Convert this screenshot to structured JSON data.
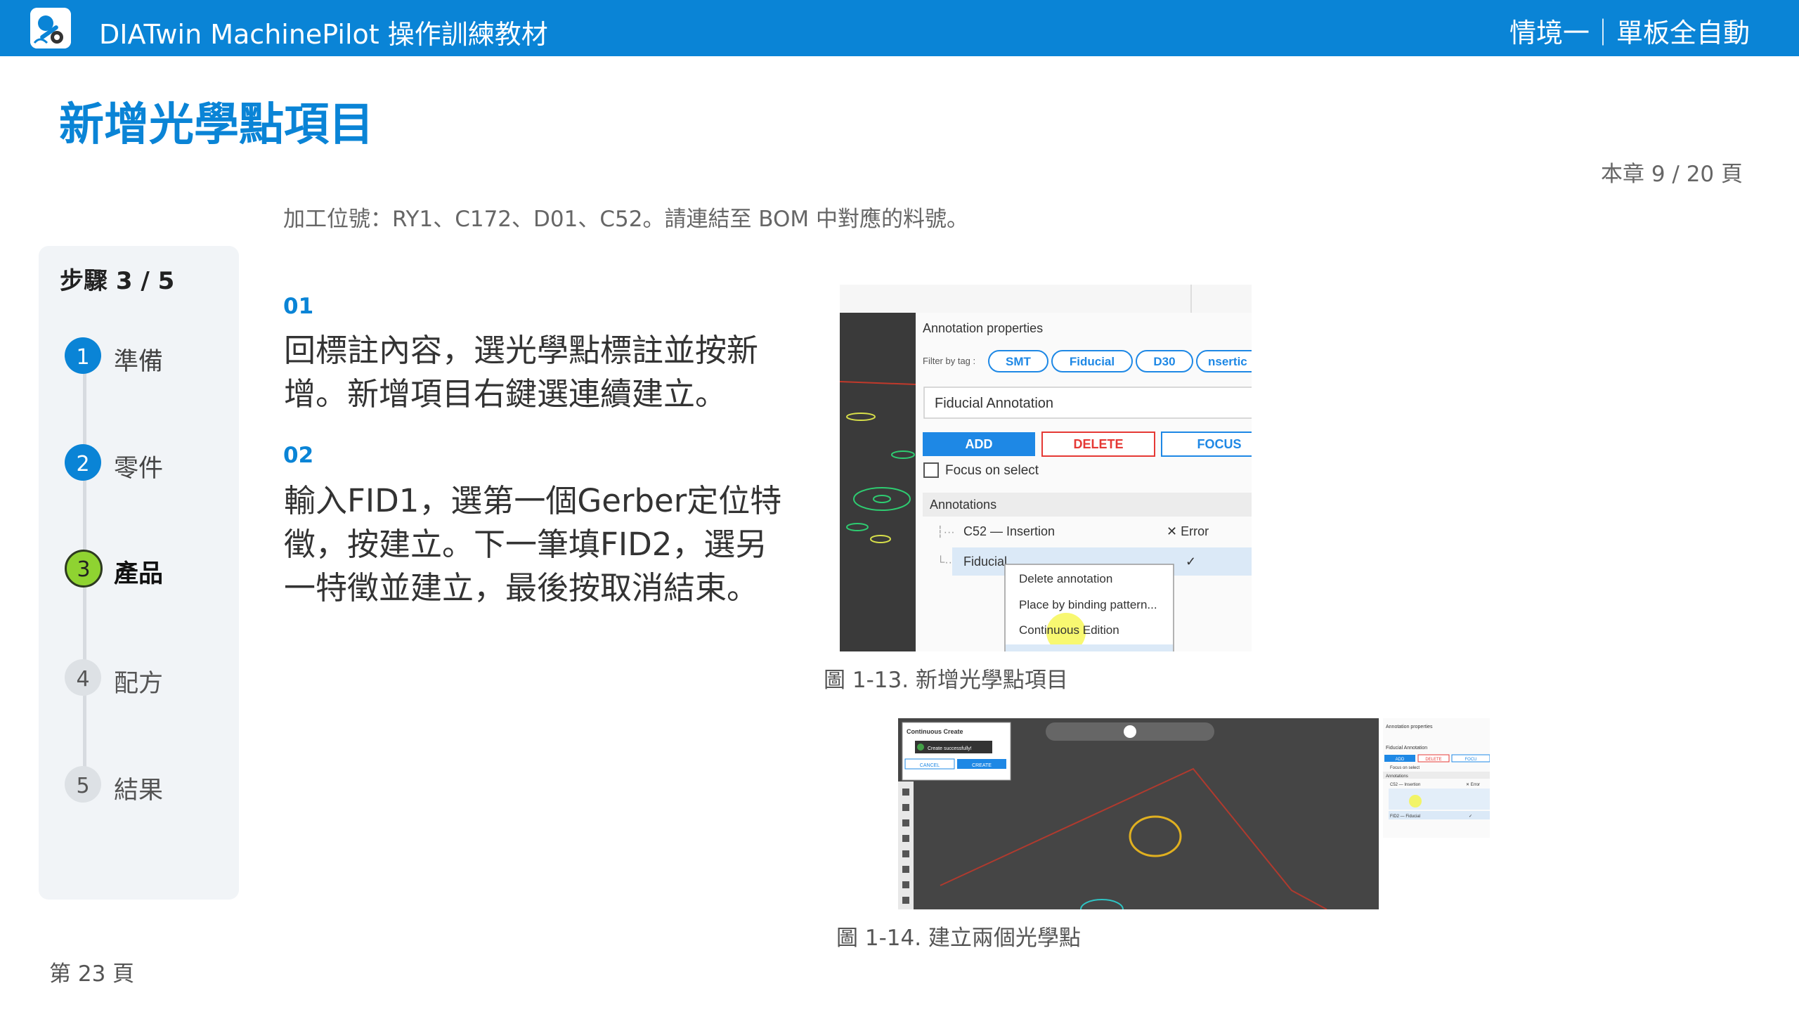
{
  "header": {
    "app_title": "DIATwin MachinePilot 操作訓練教材",
    "chapter_title": "情境一｜單板全自動",
    "accent_color": "#0a84d6"
  },
  "page": {
    "title": "新增光學點項目",
    "chapter_page": "本章 9 / 20 頁",
    "instruction": "加工位號：RY1、C172、D01、C52。請連結至 BOM 中對應的料號。",
    "footer": "第 23 頁"
  },
  "steps": {
    "heading": "步驟 3 / 5",
    "items": [
      {
        "num": "1",
        "label": "準備",
        "state": "done"
      },
      {
        "num": "2",
        "label": "零件",
        "state": "done"
      },
      {
        "num": "3",
        "label": "產品",
        "state": "current"
      },
      {
        "num": "4",
        "label": "配方",
        "state": "pending"
      },
      {
        "num": "5",
        "label": "結果",
        "state": "pending"
      }
    ]
  },
  "content": {
    "items": [
      {
        "num": "01",
        "text": "回標註內容，選光學點標註並按新增。新增項目右鍵選連續建立。"
      },
      {
        "num": "02",
        "text": "輸入FID1，選第一個Gerber定位特徵，按建立。下一筆填FID2，選另一特徵並建立，最後按取消結束。"
      }
    ]
  },
  "figures": [
    {
      "caption": "圖 1-13. 新增光學點項目",
      "panel_title": "Annotation properties",
      "filter_label": "Filter by tag :",
      "tags": [
        "SMT",
        "Fiducial",
        "D30",
        "nsertic"
      ],
      "dropdown_value": "Fiducial Annotation",
      "buttons": [
        "ADD",
        "DELETE",
        "FOCUS"
      ],
      "checkbox_label": "Focus on select",
      "annotations_header": "Annotations",
      "rows": [
        {
          "name": "C52 — Insertion",
          "status": "✕ Error"
        },
        {
          "name": "Fiducial",
          "status": "✓"
        }
      ],
      "context_menu": [
        "Delete annotation",
        "Place by binding pattern...",
        "Continuous Edition"
      ]
    },
    {
      "caption": "圖 1-14. 建立兩個光學點",
      "dialog_title": "Continuous Create",
      "toast": "Create successfully!",
      "dialog_buttons": [
        "CANCEL",
        "CREATE"
      ],
      "panel_title": "Annotation properties",
      "dropdown_value": "Fiducial Annotation",
      "buttons": [
        "ADD",
        "DELETE",
        "FOCU"
      ],
      "checkbox_label": "Focus on select",
      "annotations_header": "Annotations",
      "rows": [
        {
          "name": "C52 — Insertion",
          "status": "✕ Error"
        },
        {
          "name": "FID2 — Fiducial",
          "status": "✓"
        }
      ]
    }
  ]
}
